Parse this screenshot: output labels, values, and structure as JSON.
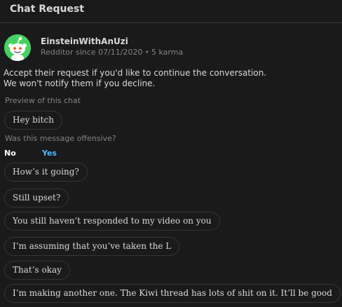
{
  "header": {
    "title": "Chat Request"
  },
  "user": {
    "name": "EinsteinWithAnUzi",
    "since": "Redditor since 07/11/2020",
    "separator": "•",
    "karma": "5 karma"
  },
  "notice": {
    "line1": "Accept their request if you'd like to continue the conversation.",
    "line2": "We won't notify them if you decline."
  },
  "preview": {
    "label": "Preview of this chat",
    "first_message": "Hey bitch"
  },
  "offensive": {
    "question": "Was this message offensive?",
    "no_label": "No",
    "yes_label": "Yes"
  },
  "messages": [
    "How’s it going?",
    "Still upset?",
    "You still haven’t responded to my video on you",
    "I’m assuming that you’ve taken the L",
    "That’s okay",
    "I’m making another one. The Kiwi thread has lots of shit on it. It’ll be good"
  ],
  "colors": {
    "background": "#1a1a1b",
    "avatar_bg": "#46d160",
    "yes_accent": "#4fbcff"
  },
  "icons": {
    "avatar": "snoo-avatar-icon"
  }
}
